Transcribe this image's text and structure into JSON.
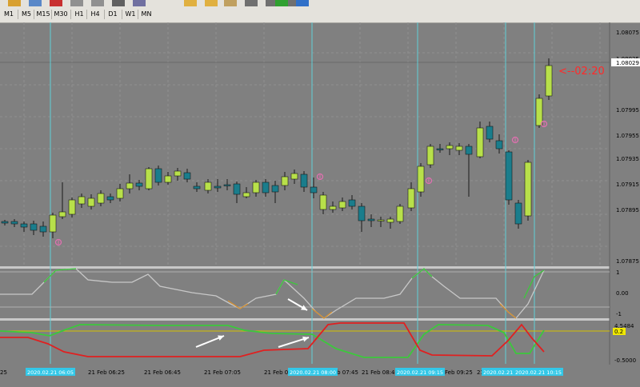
{
  "toolbar": {
    "timeframes": [
      {
        "label": "M1"
      },
      {
        "label": "M5"
      },
      {
        "label": "M15"
      },
      {
        "label": "M30"
      },
      {
        "label": "H1"
      },
      {
        "label": "H4"
      },
      {
        "label": "D1"
      },
      {
        "label": "W1"
      },
      {
        "label": "MN"
      }
    ],
    "icons": [
      "folder-icon",
      "profile-icon",
      "new-order-icon",
      "crosshair-icon",
      "cursor-icon",
      "line-icon",
      "tiles-icon",
      "zoom-in-icon",
      "zoom-out-icon",
      "template-icon",
      "grid-icon",
      "scroll-icon",
      "shift-icon",
      "add-indicator-icon",
      "period-icon"
    ]
  },
  "colors": {
    "background": "#808080",
    "grid": "#8f8f8f",
    "bull_candle": "#b8e04a",
    "bear_candle": "#1a7d8c",
    "vline": "#5fd0d8",
    "marker": "#e070b0",
    "countdown": "#ff2a2a",
    "osc_green": "#3cc83c",
    "osc_red": "#e02020",
    "level_yellow": "#d4c000",
    "date_highlight": "#33c8e8",
    "arrow": "#ffffff"
  },
  "price_axis": {
    "labels": [
      "1.08075",
      "1.08035",
      "1.07995",
      "1.07955",
      "1.07935",
      "1.07915",
      "1.07895",
      "1.07875"
    ],
    "current_price": "1.08029",
    "countdown": "<--02:20"
  },
  "osc1_axis": {
    "labels": [
      "1",
      "0.00",
      "-1"
    ]
  },
  "osc2_axis": {
    "labels": [
      "4.5484",
      "0.2",
      "-0.5000"
    ]
  },
  "time_axis": {
    "labels": [
      "25",
      "21 Feb 06:25",
      "21 Feb 06:45",
      "21 Feb 07:05",
      "21 Feb 07:25",
      "21 Feb 07:45",
      "21 Feb 08:45",
      "Feb 09:25",
      "21"
    ],
    "highlights": [
      "2020.02.21 06:05",
      "2020.02.21 08:00",
      "2020.02.21 09:15",
      "2020.02.21 10:00",
      "2020.02.21 10:15"
    ]
  }
}
